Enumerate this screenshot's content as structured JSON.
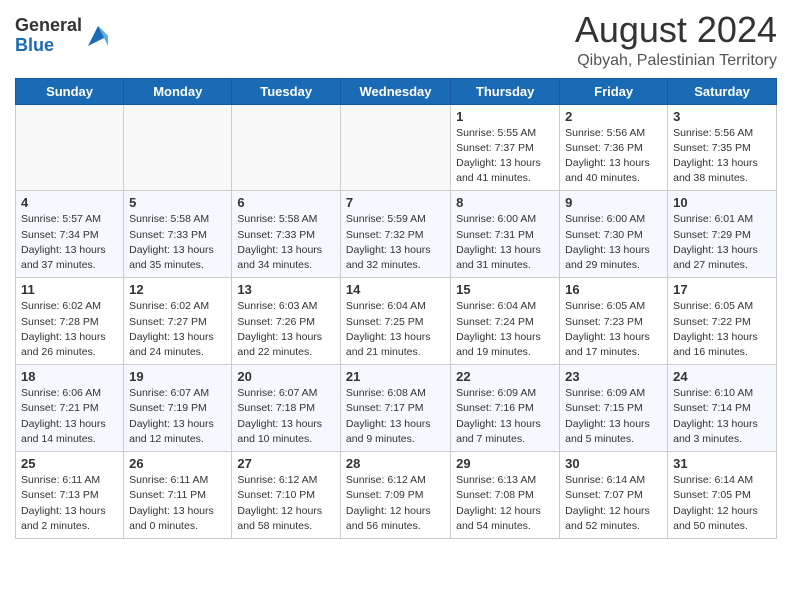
{
  "header": {
    "logo_general": "General",
    "logo_blue": "Blue",
    "month_year": "August 2024",
    "location": "Qibyah, Palestinian Territory"
  },
  "days_of_week": [
    "Sunday",
    "Monday",
    "Tuesday",
    "Wednesday",
    "Thursday",
    "Friday",
    "Saturday"
  ],
  "weeks": [
    [
      {
        "day": "",
        "info": ""
      },
      {
        "day": "",
        "info": ""
      },
      {
        "day": "",
        "info": ""
      },
      {
        "day": "",
        "info": ""
      },
      {
        "day": "1",
        "info": "Sunrise: 5:55 AM\nSunset: 7:37 PM\nDaylight: 13 hours\nand 41 minutes."
      },
      {
        "day": "2",
        "info": "Sunrise: 5:56 AM\nSunset: 7:36 PM\nDaylight: 13 hours\nand 40 minutes."
      },
      {
        "day": "3",
        "info": "Sunrise: 5:56 AM\nSunset: 7:35 PM\nDaylight: 13 hours\nand 38 minutes."
      }
    ],
    [
      {
        "day": "4",
        "info": "Sunrise: 5:57 AM\nSunset: 7:34 PM\nDaylight: 13 hours\nand 37 minutes."
      },
      {
        "day": "5",
        "info": "Sunrise: 5:58 AM\nSunset: 7:33 PM\nDaylight: 13 hours\nand 35 minutes."
      },
      {
        "day": "6",
        "info": "Sunrise: 5:58 AM\nSunset: 7:33 PM\nDaylight: 13 hours\nand 34 minutes."
      },
      {
        "day": "7",
        "info": "Sunrise: 5:59 AM\nSunset: 7:32 PM\nDaylight: 13 hours\nand 32 minutes."
      },
      {
        "day": "8",
        "info": "Sunrise: 6:00 AM\nSunset: 7:31 PM\nDaylight: 13 hours\nand 31 minutes."
      },
      {
        "day": "9",
        "info": "Sunrise: 6:00 AM\nSunset: 7:30 PM\nDaylight: 13 hours\nand 29 minutes."
      },
      {
        "day": "10",
        "info": "Sunrise: 6:01 AM\nSunset: 7:29 PM\nDaylight: 13 hours\nand 27 minutes."
      }
    ],
    [
      {
        "day": "11",
        "info": "Sunrise: 6:02 AM\nSunset: 7:28 PM\nDaylight: 13 hours\nand 26 minutes."
      },
      {
        "day": "12",
        "info": "Sunrise: 6:02 AM\nSunset: 7:27 PM\nDaylight: 13 hours\nand 24 minutes."
      },
      {
        "day": "13",
        "info": "Sunrise: 6:03 AM\nSunset: 7:26 PM\nDaylight: 13 hours\nand 22 minutes."
      },
      {
        "day": "14",
        "info": "Sunrise: 6:04 AM\nSunset: 7:25 PM\nDaylight: 13 hours\nand 21 minutes."
      },
      {
        "day": "15",
        "info": "Sunrise: 6:04 AM\nSunset: 7:24 PM\nDaylight: 13 hours\nand 19 minutes."
      },
      {
        "day": "16",
        "info": "Sunrise: 6:05 AM\nSunset: 7:23 PM\nDaylight: 13 hours\nand 17 minutes."
      },
      {
        "day": "17",
        "info": "Sunrise: 6:05 AM\nSunset: 7:22 PM\nDaylight: 13 hours\nand 16 minutes."
      }
    ],
    [
      {
        "day": "18",
        "info": "Sunrise: 6:06 AM\nSunset: 7:21 PM\nDaylight: 13 hours\nand 14 minutes."
      },
      {
        "day": "19",
        "info": "Sunrise: 6:07 AM\nSunset: 7:19 PM\nDaylight: 13 hours\nand 12 minutes."
      },
      {
        "day": "20",
        "info": "Sunrise: 6:07 AM\nSunset: 7:18 PM\nDaylight: 13 hours\nand 10 minutes."
      },
      {
        "day": "21",
        "info": "Sunrise: 6:08 AM\nSunset: 7:17 PM\nDaylight: 13 hours\nand 9 minutes."
      },
      {
        "day": "22",
        "info": "Sunrise: 6:09 AM\nSunset: 7:16 PM\nDaylight: 13 hours\nand 7 minutes."
      },
      {
        "day": "23",
        "info": "Sunrise: 6:09 AM\nSunset: 7:15 PM\nDaylight: 13 hours\nand 5 minutes."
      },
      {
        "day": "24",
        "info": "Sunrise: 6:10 AM\nSunset: 7:14 PM\nDaylight: 13 hours\nand 3 minutes."
      }
    ],
    [
      {
        "day": "25",
        "info": "Sunrise: 6:11 AM\nSunset: 7:13 PM\nDaylight: 13 hours\nand 2 minutes."
      },
      {
        "day": "26",
        "info": "Sunrise: 6:11 AM\nSunset: 7:11 PM\nDaylight: 13 hours\nand 0 minutes."
      },
      {
        "day": "27",
        "info": "Sunrise: 6:12 AM\nSunset: 7:10 PM\nDaylight: 12 hours\nand 58 minutes."
      },
      {
        "day": "28",
        "info": "Sunrise: 6:12 AM\nSunset: 7:09 PM\nDaylight: 12 hours\nand 56 minutes."
      },
      {
        "day": "29",
        "info": "Sunrise: 6:13 AM\nSunset: 7:08 PM\nDaylight: 12 hours\nand 54 minutes."
      },
      {
        "day": "30",
        "info": "Sunrise: 6:14 AM\nSunset: 7:07 PM\nDaylight: 12 hours\nand 52 minutes."
      },
      {
        "day": "31",
        "info": "Sunrise: 6:14 AM\nSunset: 7:05 PM\nDaylight: 12 hours\nand 50 minutes."
      }
    ]
  ]
}
